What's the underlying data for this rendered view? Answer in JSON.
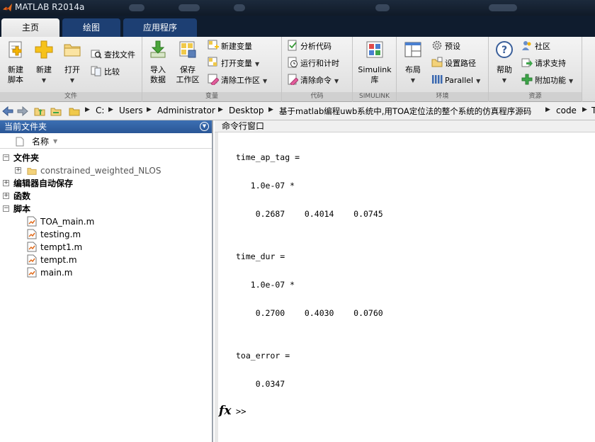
{
  "window": {
    "title": "MATLAB R2014a"
  },
  "tabs": [
    {
      "label": "主页",
      "active": true
    },
    {
      "label": "绘图",
      "active": false
    },
    {
      "label": "应用程序",
      "active": false
    }
  ],
  "ribbon": {
    "file": {
      "group_label": "文件",
      "new_script": "新建\n脚本",
      "new": "新建",
      "open": "打开",
      "find_files": "查找文件",
      "compare": "比较"
    },
    "variable": {
      "group_label": "变量",
      "import": "导入\n数据",
      "save_workspace": "保存\n工作区",
      "new_variable": "新建变量",
      "open_variable": "打开变量",
      "clear_workspace": "清除工作区"
    },
    "code": {
      "group_label": "代码",
      "analyze": "分析代码",
      "run_time": "运行和计时",
      "clear_commands": "清除命令"
    },
    "simulink": {
      "group_label": "SIMULINK",
      "library": "Simulink\n库"
    },
    "environment": {
      "group_label": "环境",
      "layout": "布局",
      "preferences": "预设",
      "set_path": "设置路径",
      "parallel": "Parallel"
    },
    "resources": {
      "group_label": "资源",
      "help": "帮助",
      "community": "社区",
      "request_support": "请求支持",
      "addons": "附加功能"
    }
  },
  "address_bar": {
    "path": [
      "C:",
      "Users",
      "Administrator",
      "Desktop",
      "基于matlab编程uwb系统中,用TOA定位法的整个系统的仿真程序源码",
      "code",
      "T"
    ]
  },
  "current_folder": {
    "title": "当前文件夹",
    "column_name": "名称",
    "sections": [
      {
        "label": "文件夹",
        "items": [
          "constrained_weighted_NLOS"
        ]
      },
      {
        "label": "编辑器自动保存",
        "items": []
      },
      {
        "label": "函数",
        "items": []
      },
      {
        "label": "脚本",
        "items": [
          "TOA_main.m",
          "testing.m",
          "tempt1.m",
          "tempt.m",
          "main.m"
        ]
      }
    ]
  },
  "command_window": {
    "title": "命令行窗口",
    "lines": [
      "time_ap_tag =",
      "   1.0e-07 *",
      "    0.2687    0.4014    0.0745",
      "time_dur =",
      "   1.0e-07 *",
      "    0.2700    0.4030    0.0760",
      "toa_error =",
      "    0.0347"
    ],
    "fx": "fx",
    "prompt": ">>"
  },
  "colors": {
    "tab_active_bg": "#e8e8e8",
    "tab_inactive_bg": "#1d3f73",
    "panel_header": "#2f5f9f",
    "titlebar": "#142235"
  }
}
